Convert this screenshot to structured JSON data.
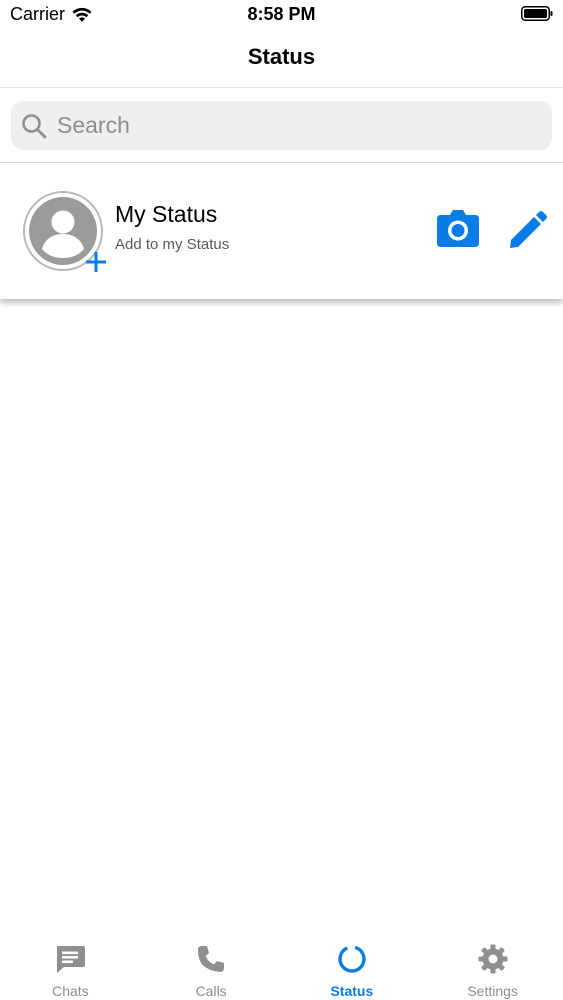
{
  "status_bar": {
    "carrier": "Carrier",
    "time": "8:58 PM"
  },
  "nav": {
    "title": "Status"
  },
  "search": {
    "placeholder": "Search"
  },
  "my_status": {
    "name": "My Status",
    "subtitle": "Add to my Status"
  },
  "colors": {
    "accent": "#0a7ce6",
    "inactive": "#8e8e93",
    "icon_gray": "#9a9a9a"
  },
  "tabs": [
    {
      "label": "Chats",
      "icon": "chat-icon",
      "active": false
    },
    {
      "label": "Calls",
      "icon": "phone-icon",
      "active": false
    },
    {
      "label": "Status",
      "icon": "status-ring-icon",
      "active": true
    },
    {
      "label": "Settings",
      "icon": "gear-icon",
      "active": false
    }
  ]
}
